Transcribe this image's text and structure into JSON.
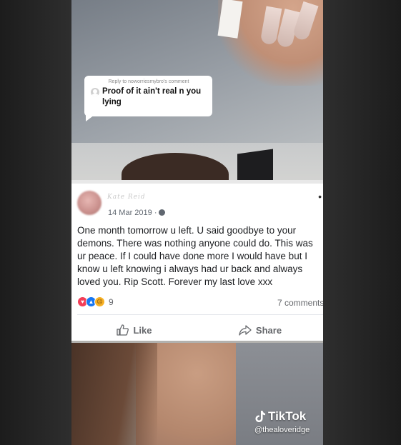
{
  "reply": {
    "header": "Reply to noworriesmybro's comment",
    "text": "Proof of it ain't real n you lying"
  },
  "post": {
    "author": "Kate Reid",
    "date": "14 Mar 2019 ·",
    "more": "•",
    "text": "One month tomorrow u left. U said goodbye to your demons. There was nothing anyone could do. This was ur peace. If I could have done more I would have but I know u left knowing i always had ur back and always loved you. Rip Scott. Forever my last love xxx",
    "reaction_count": "9",
    "comments": "7 comments",
    "like_label": "Like",
    "share_label": "Share",
    "reactions": [
      "love-icon",
      "like-icon",
      "sad-icon"
    ]
  },
  "watermark": {
    "brand": "TikTok",
    "handle": "@thealoveridge"
  }
}
